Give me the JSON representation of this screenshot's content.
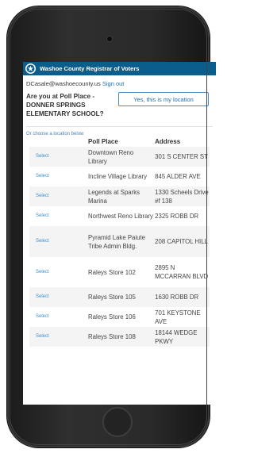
{
  "header": {
    "title": "Washoe County Registrar of Voters",
    "logo": "county-seal"
  },
  "user": {
    "email": "DCasale@washoecounty.us",
    "sign_out": "Sign out"
  },
  "poll": {
    "question": "Are you at Poll Place - DONNER SPRINGS ELEMENTARY SCHOOL?",
    "confirm_button": "Yes, this is my location"
  },
  "choose_label": "Or choose a location below",
  "table": {
    "headers": [
      "Poll Place",
      "Address"
    ],
    "rows": [
      {
        "action": "Select",
        "place": "Downtown Reno Library",
        "address": "301 S CENTER ST"
      },
      {
        "action": "Select",
        "place": "Incline Village Library",
        "address": "845 ALDER AVE"
      },
      {
        "action": "Select",
        "place": "Legends at Sparks Marina",
        "address": "1330 Scheels Drive #f 138"
      },
      {
        "action": "Select",
        "place": "Northwest Reno Library",
        "address": "2325 ROBB DR"
      },
      {
        "action": "Select",
        "place": "Pyramid Lake Paiute Tribe Admin Bldg.",
        "address": "208 CAPITOL HILL"
      },
      {
        "action": "Select",
        "place": "Raleys Store 102",
        "address": "2895 N MCCARRAN BLVD"
      },
      {
        "action": "Select",
        "place": "Raleys Store 105",
        "address": "1630 ROBB DR"
      },
      {
        "action": "Select",
        "place": "Raleys Store 106",
        "address": "701 KEYSTONE AVE"
      },
      {
        "action": "Select",
        "place": "Raleys Store 108",
        "address": "18144 WEDGE PKWY"
      }
    ]
  },
  "colors": {
    "header_bg": "#0b5e8c",
    "link": "#1f6fb6",
    "select_link": "#3a8fd0"
  }
}
